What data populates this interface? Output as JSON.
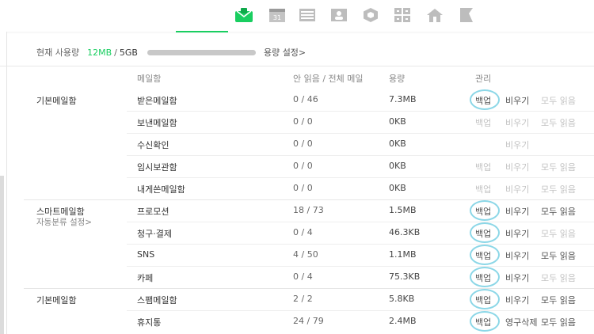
{
  "usage": {
    "label": "현재 사용량",
    "used": "12MB",
    "separator": "/",
    "total": "5GB",
    "used_fraction": 0.0023,
    "settings_link": "용량 설정>"
  },
  "columns": {
    "mailbox": "메일함",
    "unread_total": "안 읽음 / 전체 메일",
    "size": "용량",
    "manage": "관리"
  },
  "groups": [
    {
      "label": "기본메일함",
      "sublabel": ""
    },
    {
      "label": "스마트메일함",
      "sublabel": "자동분류 설정>"
    },
    {
      "label": "기본메일함",
      "sublabel": ""
    }
  ],
  "rows": [
    {
      "name": "받은메일함",
      "count": "0 / 46",
      "size": "7.3MB",
      "a1": "백업",
      "a2": "비우기",
      "a3": "모두 읽음"
    },
    {
      "name": "보낸메일함",
      "count": "0 / 0",
      "size": "0KB",
      "a1": "백업",
      "a2": "비우기",
      "a3": "모두 읽음"
    },
    {
      "name": "수신확인",
      "count": "0 / 0",
      "size": "0KB",
      "a1": "",
      "a2": "비우기",
      "a3": ""
    },
    {
      "name": "임시보관함",
      "count": "0 / 0",
      "size": "0KB",
      "a1": "백업",
      "a2": "비우기",
      "a3": "모두 읽음"
    },
    {
      "name": "내게쓴메일함",
      "count": "0 / 0",
      "size": "0KB",
      "a1": "백업",
      "a2": "비우기",
      "a3": "모두 읽음"
    },
    {
      "name": "프로모션",
      "count": "18 / 73",
      "size": "1.5MB",
      "a1": "백업",
      "a2": "비우기",
      "a3": "모두 읽음"
    },
    {
      "name": "청구·결제",
      "count": "0 / 4",
      "size": "46.3KB",
      "a1": "백업",
      "a2": "비우기",
      "a3": "모두 읽음"
    },
    {
      "name": "SNS",
      "count": "4 / 50",
      "size": "1.1MB",
      "a1": "백업",
      "a2": "비우기",
      "a3": "모두 읽음"
    },
    {
      "name": "카페",
      "count": "0 / 4",
      "size": "75.3KB",
      "a1": "백업",
      "a2": "비우기",
      "a3": "모두 읽음"
    },
    {
      "name": "스팸메일함",
      "count": "2 / 2",
      "size": "5.8KB",
      "a1": "백업",
      "a2": "비우기",
      "a3": "모두 읽음"
    },
    {
      "name": "휴지통",
      "count": "24 / 79",
      "size": "2.4MB",
      "a1": "백업",
      "a2": "영구삭제",
      "a3": "모두 읽음"
    }
  ],
  "topbar_icons": [
    "mail-icon",
    "calendar-icon",
    "list-icon",
    "contacts-icon",
    "box-icon",
    "grid-icon",
    "home-icon",
    "flag-icon"
  ],
  "colors": {
    "accent": "#19ce60",
    "highlight": "#8cd7e7"
  }
}
